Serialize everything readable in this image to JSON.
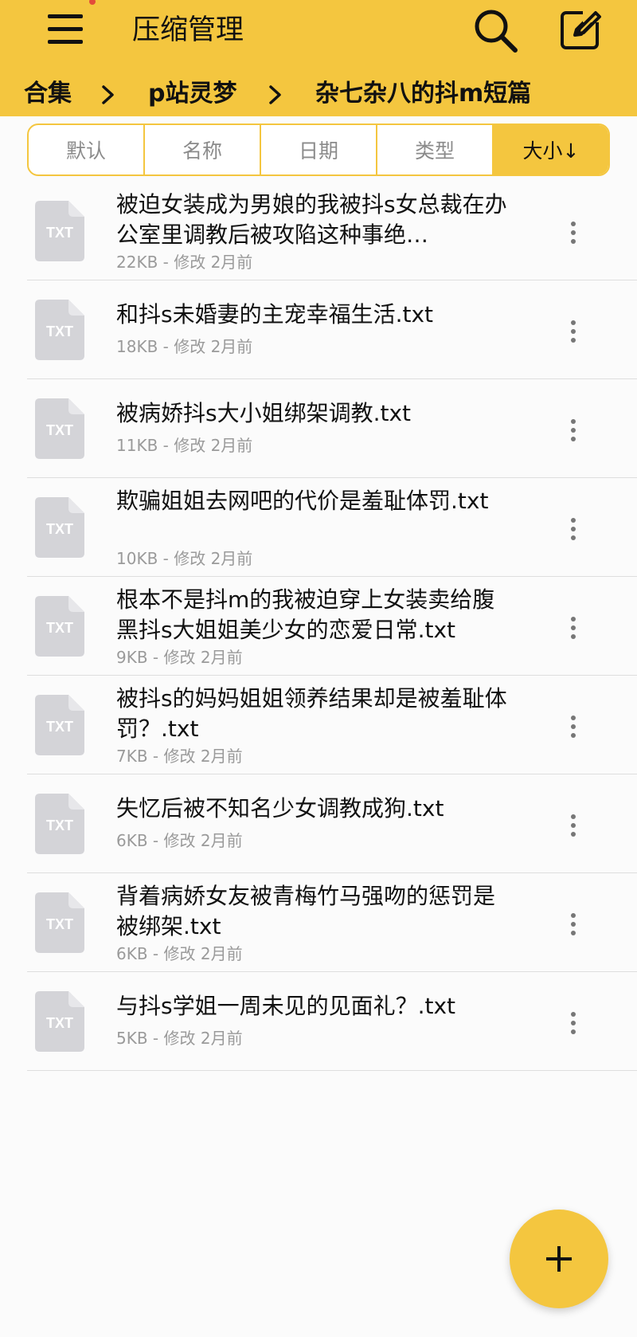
{
  "header": {
    "title": "压缩管理",
    "menu_icon": "hamburger-menu-icon",
    "search_icon": "search-icon",
    "edit_icon": "edit-icon",
    "accent": "#f4c63f"
  },
  "breadcrumb": [
    "合集",
    "p站灵梦",
    "杂七杂八的抖m短篇"
  ],
  "sort": {
    "items": [
      "默认",
      "名称",
      "日期",
      "类型",
      "大小↓"
    ],
    "active_index": 4
  },
  "files": [
    {
      "name": "被迫女装成为男娘的我被抖s女总裁在办公室里调教后被攻陷这种事绝…",
      "meta": "22KB - 修改 2月前",
      "icon": "TXT"
    },
    {
      "name": "和抖s未婚妻的主宠幸福生活.txt",
      "meta": "18KB - 修改 2月前",
      "icon": "TXT"
    },
    {
      "name": "被病娇抖s大小姐绑架调教.txt",
      "meta": "11KB - 修改 2月前",
      "icon": "TXT"
    },
    {
      "name": "欺骗姐姐去网吧的代价是羞耻体罚.txt",
      "meta": "10KB - 修改 2月前",
      "icon": "TXT"
    },
    {
      "name": "根本不是抖m的我被迫穿上女装卖给腹黑抖s大姐姐美少女的恋爱日常.txt",
      "meta": "9KB - 修改 2月前",
      "icon": "TXT"
    },
    {
      "name": "被抖s的妈妈姐姐领养结果却是被羞耻体罚？.txt",
      "meta": "7KB - 修改 2月前",
      "icon": "TXT"
    },
    {
      "name": "失忆后被不知名少女调教成狗.txt",
      "meta": "6KB - 修改 2月前",
      "icon": "TXT"
    },
    {
      "name": "背着病娇女友被青梅竹马强吻的惩罚是被绑架.txt",
      "meta": "6KB - 修改 2月前",
      "icon": "TXT"
    },
    {
      "name": "与抖s学姐一周未见的见面礼？.txt",
      "meta": "5KB - 修改 2月前",
      "icon": "TXT"
    }
  ],
  "fab": {
    "icon": "plus-icon"
  }
}
